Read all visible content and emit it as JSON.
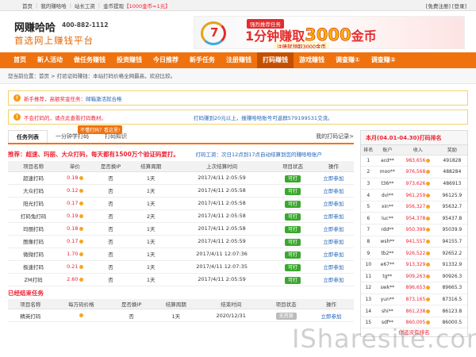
{
  "topbar": {
    "links": [
      "首页",
      "我的赚哈哈",
      "站长工资",
      "金币提现"
    ],
    "rate": "【1000金币=1元】",
    "right": "[免费注册] [登录]"
  },
  "logo": {
    "name": "网赚哈哈",
    "phone": "400-882-1112",
    "slogan": "首选网上赚钱平台"
  },
  "banner": {
    "tag": "强烈推荐任务",
    "main_prefix": "1分钟赚取",
    "amount": "3000",
    "main_suffix": "金币",
    "sub": "注册就领取3000金币"
  },
  "nav": {
    "items": [
      "首页",
      "新人活动",
      "做任务赚钱",
      "投资赚钱",
      "今日推荐",
      "新手任务",
      "注册赚钱",
      "打码赚钱",
      "游戏赚钱",
      "调查赚①",
      "调查赚②"
    ],
    "active_index": 7
  },
  "breadcrumb": "您当前位置：首页 > 打验证码赚钱：本站打码价格全网最高，欢迎比较。",
  "notice1": {
    "prefix": "新手推荐，高额奖金任务：",
    "link": "邮箱激活就合格"
  },
  "notice2": {
    "text": "不会打码的，请点此查看打码教材。",
    "right": "打码赚到20元以上，报赚哈哈账号可返群579199531交流。"
  },
  "tabs": {
    "items": [
      "任务列表",
      "一分钟学打码",
      "打码知识"
    ],
    "tip": "不懂打码？看这里!",
    "right": "我的打码记录>"
  },
  "promo": {
    "text": "推荐：超速、玛丽、大众打码，每天都有1500万个验证码要打。",
    "note": "打码工资：次日12点到17点自动结算到您的赚哈哈账户"
  },
  "task_table": {
    "headers": [
      "项目名称",
      "单价",
      "是否换IP",
      "结算周期",
      "上次结算时间",
      "项目状态",
      "操作"
    ],
    "rows": [
      [
        "超速打码",
        "0.18",
        "否",
        "1天",
        "2017/4/11 2:05:59",
        "可打",
        "立即参加"
      ],
      [
        "大众打码",
        "0.12",
        "否",
        "1天",
        "2017/4/11 2:05:58",
        "可打",
        "立即参加"
      ],
      [
        "阳光打码",
        "0.17",
        "否",
        "1天",
        "2017/4/11 2:05:58",
        "可打",
        "立即参加"
      ],
      [
        "打码兔打码",
        "0.19",
        "否",
        "2天",
        "2017/4/11 2:05:58",
        "可打",
        "立即参加"
      ],
      [
        "玛丽打码",
        "0.18",
        "否",
        "1天",
        "2017/4/11 2:05:58",
        "可打",
        "立即参加"
      ],
      [
        "图像打码",
        "0.17",
        "否",
        "1天",
        "2017/4/11 2:05:59",
        "可打",
        "立即参加"
      ],
      [
        "微微打码",
        "1.70",
        "否",
        "1天",
        "2017/4/11 12:07:36",
        "可打",
        "立即参加"
      ],
      [
        "极速打码",
        "0.21",
        "否",
        "1天",
        "2017/4/11 12:07:35",
        "可打",
        "立即参加"
      ],
      [
        "ZM打码",
        "2.60",
        "否",
        "1天",
        "2017/4/11 2:05:59",
        "可打",
        "立即参加"
      ]
    ]
  },
  "ended": {
    "title": "已经结束任务",
    "headers": [
      "项目名称",
      "每万码价格",
      "是否换IP",
      "结算周期",
      "结束时间",
      "项目状态",
      "操作"
    ],
    "rows": [
      [
        "精英打码",
        "",
        "否",
        "1天",
        "2020/12/31",
        "无资源",
        "立即参加"
      ]
    ]
  },
  "ranking": {
    "title": "本月(04.01-04.30)打码排名",
    "headers": [
      "排名",
      "账户",
      "收入",
      "奖励"
    ],
    "rows": [
      [
        "1",
        "acd**",
        "983,656",
        "491828"
      ],
      [
        "2",
        "moo**",
        "976,568",
        "488284"
      ],
      [
        "3",
        "t36**",
        "973,626",
        "486913"
      ],
      [
        "4",
        "dvl**",
        "961,259",
        "96125.9"
      ],
      [
        "5",
        "xin**",
        "956,327",
        "95632.7"
      ],
      [
        "6",
        "luc**",
        "954,378",
        "95437.8"
      ],
      [
        "7",
        "rdd**",
        "950,399",
        "95039.9"
      ],
      [
        "8",
        "wsh**",
        "941,557",
        "94155.7"
      ],
      [
        "9",
        "tb2**",
        "926,522",
        "92652.2"
      ],
      [
        "10",
        "e67**",
        "913,329",
        "91332.9"
      ],
      [
        "11",
        "tg**",
        "909,263",
        "90926.3"
      ],
      [
        "12",
        "swk**",
        "896,653",
        "89665.3"
      ],
      [
        "13",
        "yun**",
        "873,165",
        "87316.5"
      ],
      [
        "14",
        "shi**",
        "861,238",
        "86123.8"
      ],
      [
        "15",
        "sdf**",
        "860,005",
        "86000.5"
      ]
    ],
    "more": "你还没有排名"
  },
  "watermark": "ISharesite.com"
}
